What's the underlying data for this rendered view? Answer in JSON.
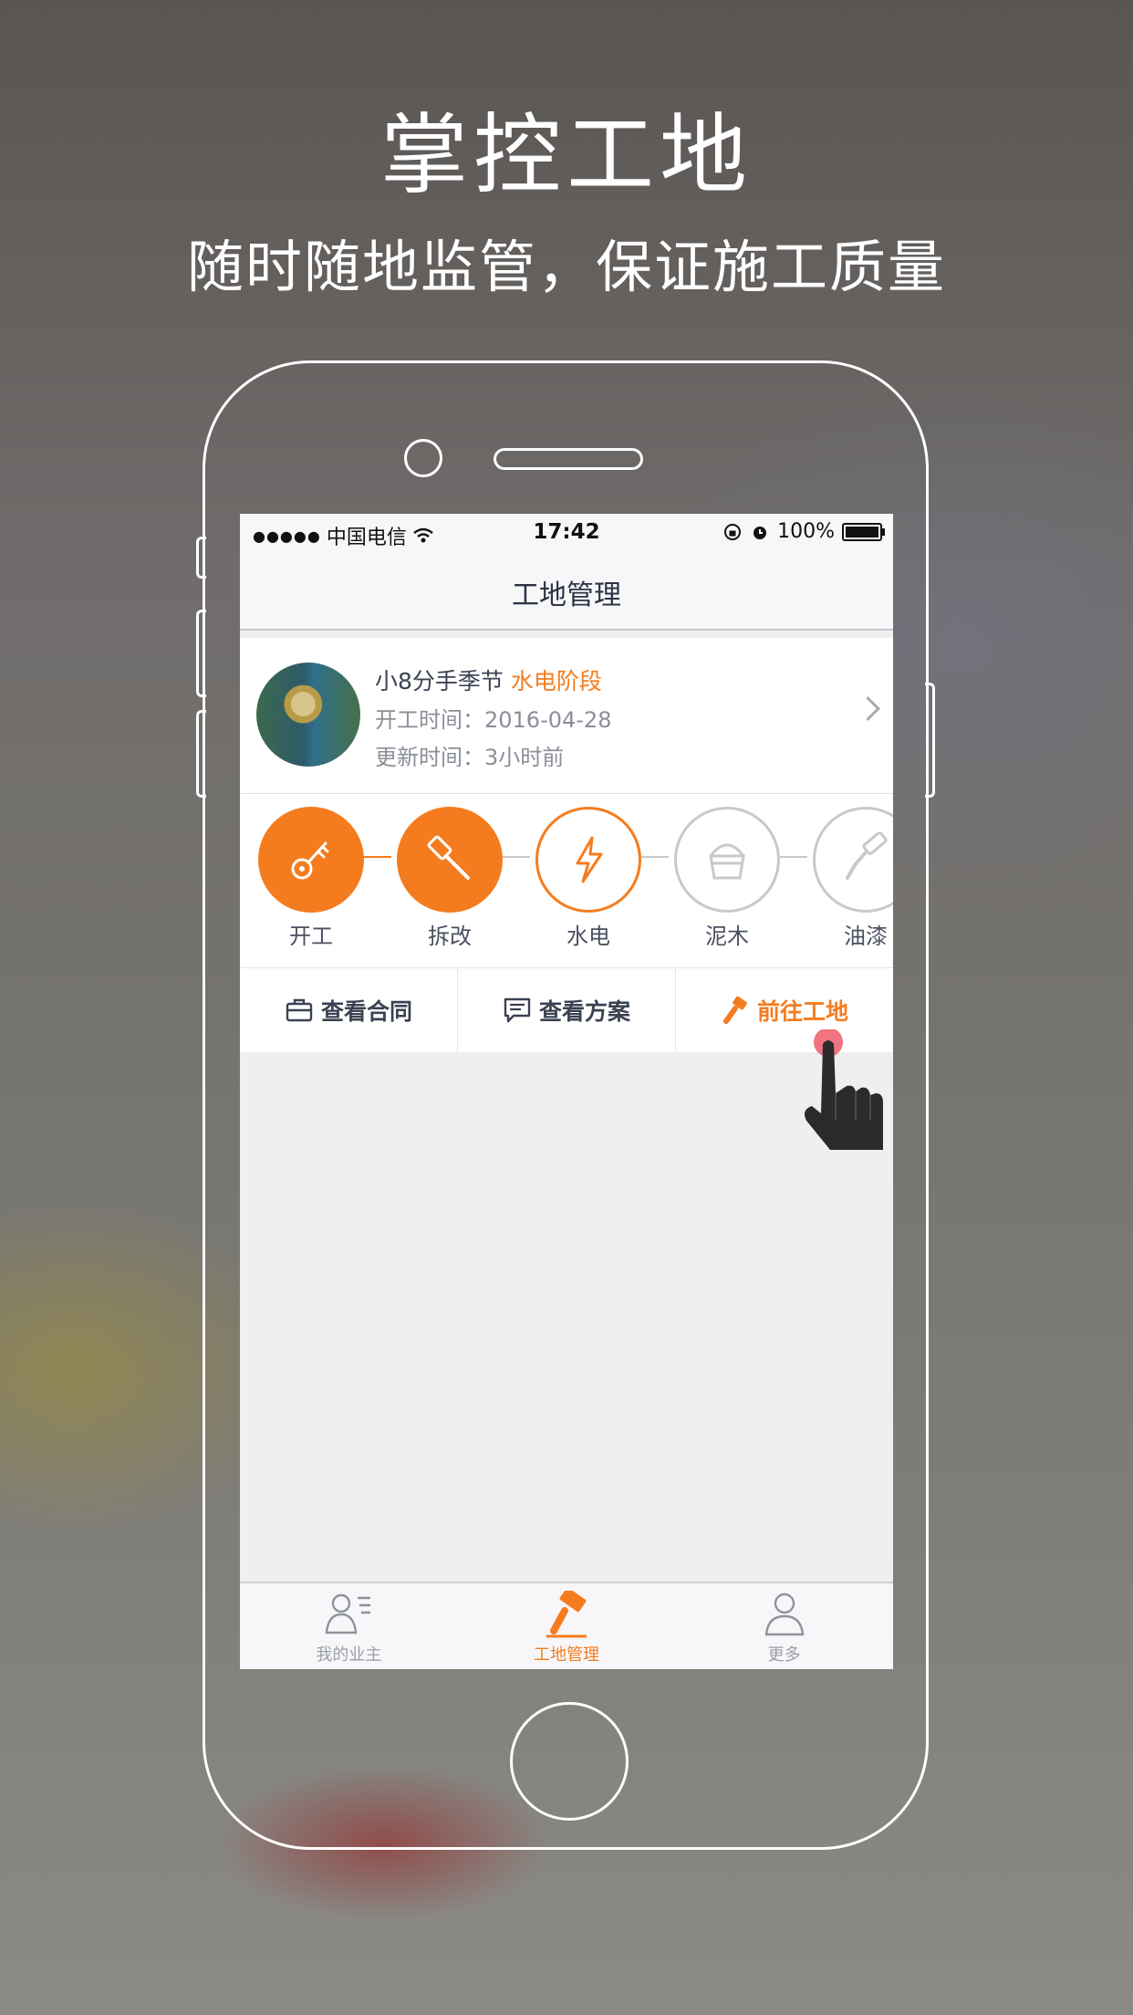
{
  "promo": {
    "title": "掌控工地",
    "subtitle": "随时随地监管，保证施工质量"
  },
  "status_bar": {
    "signal": "●●●●●",
    "carrier": "中国电信",
    "wifi_icon": "wifi-icon",
    "time": "17:42",
    "battery": "100%"
  },
  "nav": {
    "title": "工地管理"
  },
  "site": {
    "name": "小8分手季节",
    "stage": "水电阶段",
    "start_date": "开工时间：2016-04-28",
    "updated": "更新时间：3小时前"
  },
  "steps": [
    {
      "label": "开工",
      "state": "done",
      "icon": "key-icon"
    },
    {
      "label": "拆改",
      "state": "done",
      "icon": "hammer-icon"
    },
    {
      "label": "水电",
      "state": "current",
      "icon": "lightning-icon"
    },
    {
      "label": "泥木",
      "state": "todo",
      "icon": "bucket-icon"
    },
    {
      "label": "油漆",
      "state": "todo",
      "icon": "paint-roller-icon"
    }
  ],
  "actions": {
    "contract": "查看合同",
    "plan": "查看方案",
    "goto_site": "前往工地"
  },
  "tabs": {
    "owners": "我的业主",
    "site_mgmt": "工地管理",
    "more": "更多"
  },
  "colors": {
    "accent": "#f57c1e",
    "todo": "#c9c9cd"
  }
}
